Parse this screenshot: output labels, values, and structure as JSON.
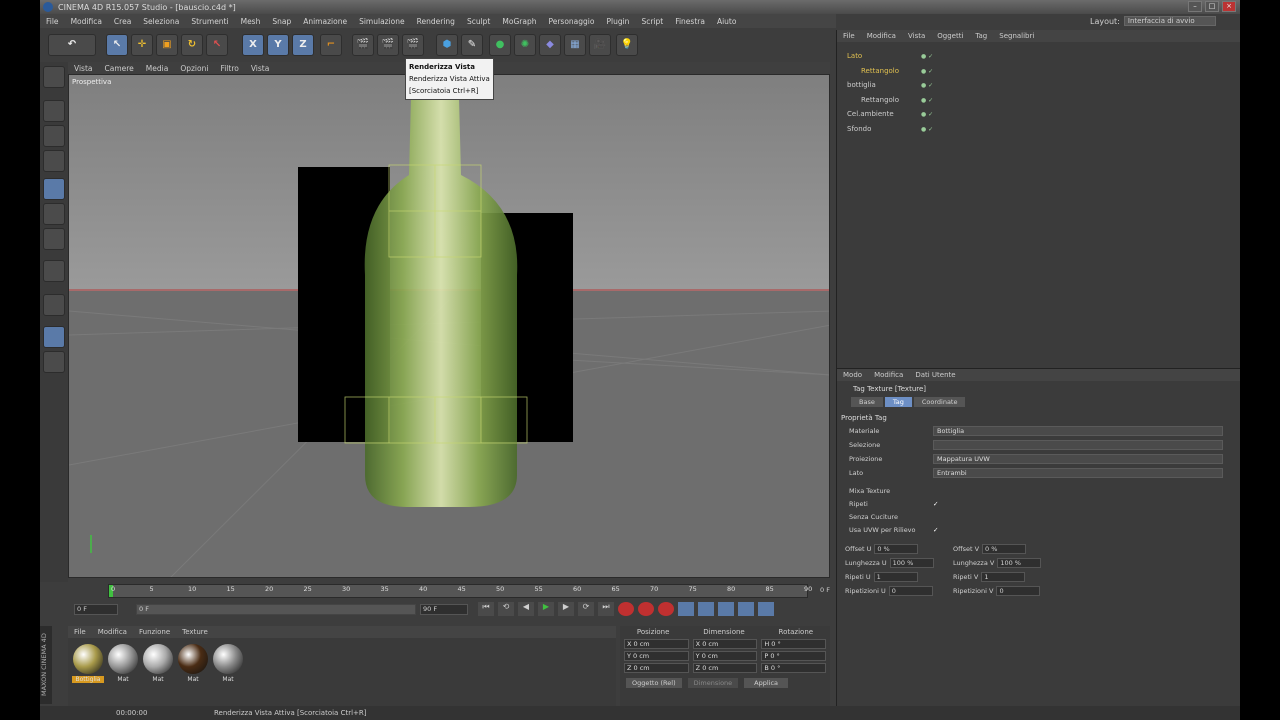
{
  "window": {
    "title": "CINEMA 4D R15.057 Studio - [bauscio.c4d *]"
  },
  "menu": [
    "File",
    "Modifica",
    "Crea",
    "Seleziona",
    "Strumenti",
    "Mesh",
    "Snap",
    "Animazione",
    "Simulazione",
    "Rendering",
    "Sculpt",
    "MoGraph",
    "Personaggio",
    "Plugin",
    "Script",
    "Finestra",
    "Aiuto"
  ],
  "layout": {
    "label": "Layout:",
    "value": "Interfaccia di avvio"
  },
  "toolbar": {
    "x": "X",
    "y": "Y",
    "z": "Z"
  },
  "tooltip": {
    "title": "Renderizza Vista",
    "line1": "Renderizza Vista Attiva",
    "line2": "[Scorciatoia Ctrl+R]"
  },
  "viewport": {
    "menu": [
      "Vista",
      "Camere",
      "Media",
      "Opzioni",
      "Filtro",
      "Vista"
    ],
    "label": "Prospettiva"
  },
  "timeline": {
    "ticks": [
      "0",
      "5",
      "10",
      "15",
      "20",
      "25",
      "30",
      "35",
      "40",
      "45",
      "50",
      "55",
      "60",
      "65",
      "70",
      "75",
      "80",
      "85",
      "90"
    ],
    "frame_end_label": "0 F",
    "start": "0 F",
    "current": "0 F",
    "end": "90 F",
    "end2": "90 F"
  },
  "materials": {
    "menu": [
      "File",
      "Modifica",
      "Funzione",
      "Texture"
    ],
    "items": [
      {
        "name": "Bottiglia",
        "color": "#a89a4a"
      },
      {
        "name": "Mat",
        "color": "#999999"
      },
      {
        "name": "Mat",
        "color": "#aaaaaa"
      },
      {
        "name": "Mat",
        "color": "#4a2c14"
      },
      {
        "name": "Mat",
        "color": "#8a8a8a"
      }
    ]
  },
  "coords": {
    "headers": [
      "Posizione",
      "Dimensione",
      "Rotazione"
    ],
    "rows": [
      [
        "X  0 cm",
        "X  0 cm",
        "H  0 °"
      ],
      [
        "Y  0 cm",
        "Y  0 cm",
        "P  0 °"
      ],
      [
        "Z  0 cm",
        "Z  0 cm",
        "B  0 °"
      ]
    ],
    "mode": "Oggetto (Rel)",
    "size_mode": "Dimensione",
    "apply": "Applica"
  },
  "objects": {
    "menu": [
      "File",
      "Modifica",
      "Vista",
      "Oggetti",
      "Tag",
      "Segnalibri"
    ],
    "rows": [
      {
        "name": "Lato",
        "indent": 0,
        "color": "#e0c050"
      },
      {
        "name": "Rettangolo",
        "indent": 1,
        "color": "#e0c050"
      },
      {
        "name": "bottiglia",
        "indent": 0,
        "color": "#cccccc"
      },
      {
        "name": "Rettangolo",
        "indent": 1,
        "color": "#cccccc"
      },
      {
        "name": "Cel.ambiente",
        "indent": 0,
        "color": "#cccccc"
      },
      {
        "name": "Sfondo",
        "indent": 0,
        "color": "#cccccc"
      }
    ]
  },
  "attributes": {
    "menu": [
      "Modo",
      "Modifica",
      "Dati Utente"
    ],
    "header": "Tag Texture [Texture]",
    "tabs": [
      "Base",
      "Tag",
      "Coordinate"
    ],
    "active_tab": "Tag",
    "section": "Proprietà Tag",
    "rows": [
      {
        "label": "Materiale",
        "value": "Bottiglia"
      },
      {
        "label": "Selezione",
        "value": ""
      },
      {
        "label": "Proiezione",
        "value": "Mappatura UVW"
      },
      {
        "label": "Lato",
        "value": "Entrambi"
      }
    ],
    "checks": [
      {
        "label": "Mixa Texture",
        "value": ""
      },
      {
        "label": "Ripeti",
        "value": "✓"
      },
      {
        "label": "Senza Cuciture",
        "value": ""
      },
      {
        "label": "Usa UVW per Rilievo",
        "value": "✓"
      }
    ],
    "offset": [
      {
        "a": "Offset U",
        "av": "0 %",
        "b": "Offset V",
        "bv": "0 %"
      },
      {
        "a": "Lunghezza U",
        "av": "100 %",
        "b": "Lunghezza V",
        "bv": "100 %"
      },
      {
        "a": "Ripeti U",
        "av": "1",
        "b": "Ripeti V",
        "bv": "1"
      },
      {
        "a": "Ripetizioni U",
        "av": "0",
        "b": "Ripetizioni V",
        "bv": "0"
      }
    ]
  },
  "status": {
    "time": "00:00:00",
    "text": "Renderizza Vista Attiva [Scorciatoia Ctrl+R]"
  },
  "brand": "MAXON CINEMA 4D"
}
